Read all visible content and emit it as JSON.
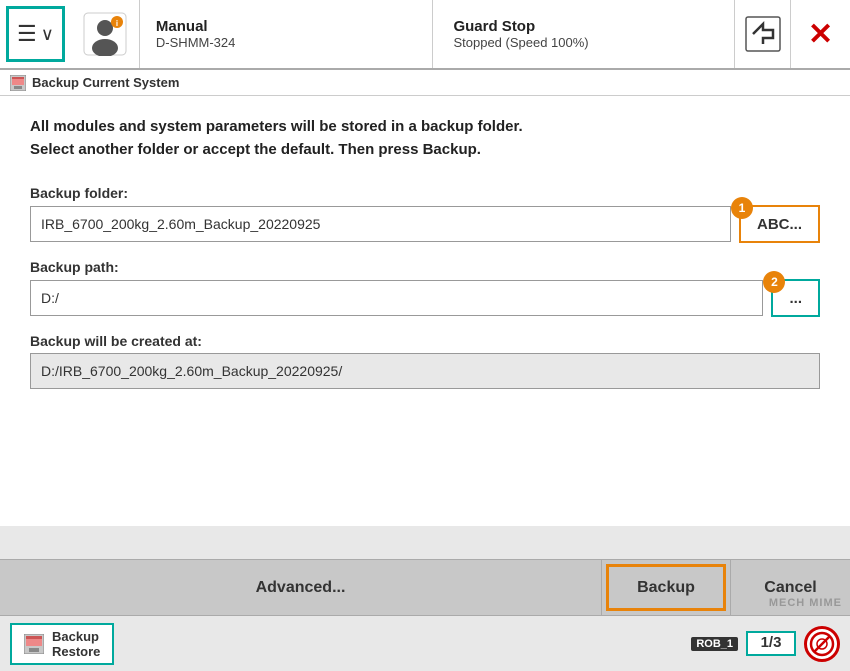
{
  "topbar": {
    "mode": "Manual",
    "device": "D-SHMM-324",
    "guard_status": "Guard Stop",
    "speed_status": "Stopped (Speed 100%)"
  },
  "subtitle": {
    "label": "Backup Current System"
  },
  "main": {
    "description_line1": "All modules and system parameters will be stored in a backup folder.",
    "description_line2": "Select another folder or accept the default. Then press Backup.",
    "backup_folder_label": "Backup folder:",
    "backup_folder_value": "IRB_6700_200kg_2.60m_Backup_20220925",
    "backup_folder_btn": "ABC...",
    "backup_path_label": "Backup path:",
    "backup_path_value": "D:/",
    "backup_path_btn": "...",
    "backup_created_label": "Backup will be created at:",
    "backup_created_value": "D:/IRB_6700_200kg_2.60m_Backup_20220925/"
  },
  "actions": {
    "advanced_label": "Advanced...",
    "backup_label": "Backup",
    "cancel_label": "Cancel"
  },
  "statusbar": {
    "backup_restore_label": "Backup\nRestore",
    "rob_label": "ROB_1",
    "fraction_top": "1/3",
    "fraction_bot": ""
  },
  "badges": {
    "folder_badge": "1",
    "path_badge": "2"
  },
  "watermark": "MECH MIME"
}
